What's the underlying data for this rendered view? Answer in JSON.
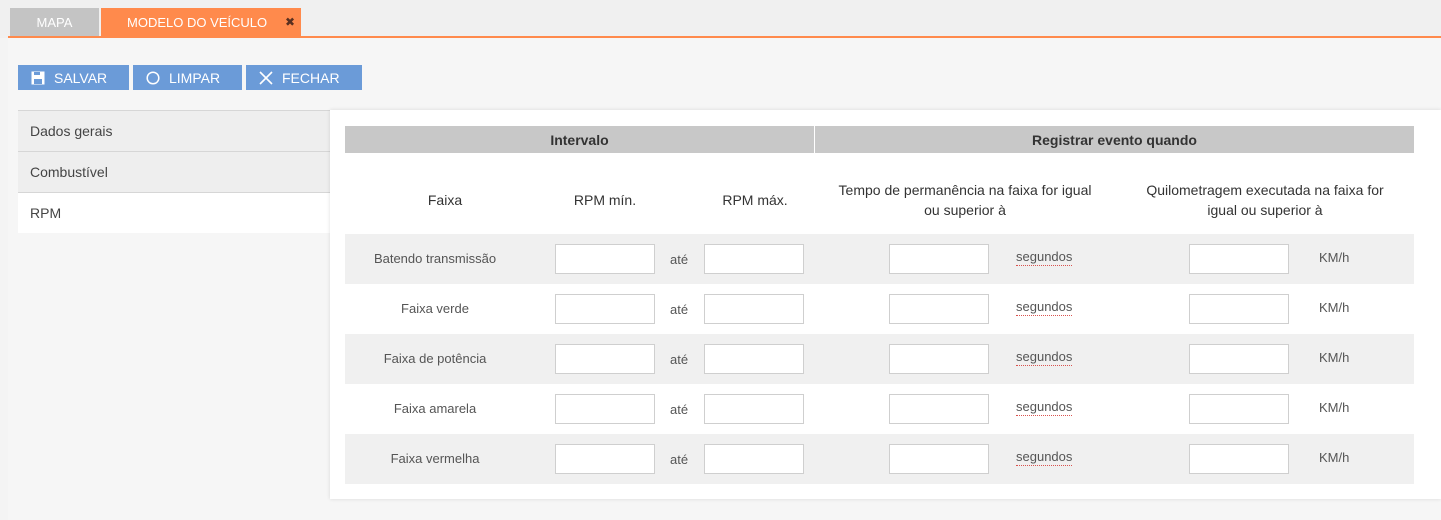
{
  "tabs": [
    {
      "label": "MAPA"
    },
    {
      "label": "MODELO DO VEÍCULO",
      "close_glyph": "✖"
    }
  ],
  "toolbar": {
    "save_label": "SALVAR",
    "clear_label": "LIMPAR",
    "close_label": "FECHAR"
  },
  "sidenav": {
    "items": [
      {
        "label": "Dados gerais"
      },
      {
        "label": "Combustível"
      },
      {
        "label": "RPM"
      }
    ],
    "active": "RPM"
  },
  "table": {
    "group_headers": {
      "interval": "Intervalo",
      "register": "Registrar evento quando"
    },
    "columns": {
      "faixa": "Faixa",
      "rpm_min": "RPM mín.",
      "rpm_max": "RPM máx.",
      "tempo": "Tempo de permanência na faixa for igual ou superior à",
      "km": "Quilometragem executada na faixa for igual ou superior à"
    },
    "rows": [
      {
        "label": "Batendo transmissão",
        "ate": "até",
        "unit_time": "segundos",
        "unit_km": "KM/h"
      },
      {
        "label": "Faixa verde",
        "ate": "até",
        "unit_time": "segundos",
        "unit_km": "KM/h"
      },
      {
        "label": "Faixa de potência",
        "ate": "até",
        "unit_time": "segundos",
        "unit_km": "KM/h"
      },
      {
        "label": "Faixa amarela",
        "ate": "até",
        "unit_time": "segundos",
        "unit_km": "KM/h"
      },
      {
        "label": "Faixa vermelha",
        "ate": "até",
        "unit_time": "segundos",
        "unit_km": "KM/h"
      }
    ]
  },
  "colors": {
    "accent_tab": "#ff8a4c",
    "button": "#6b9bd8",
    "header_gray": "#c8c8c8"
  }
}
